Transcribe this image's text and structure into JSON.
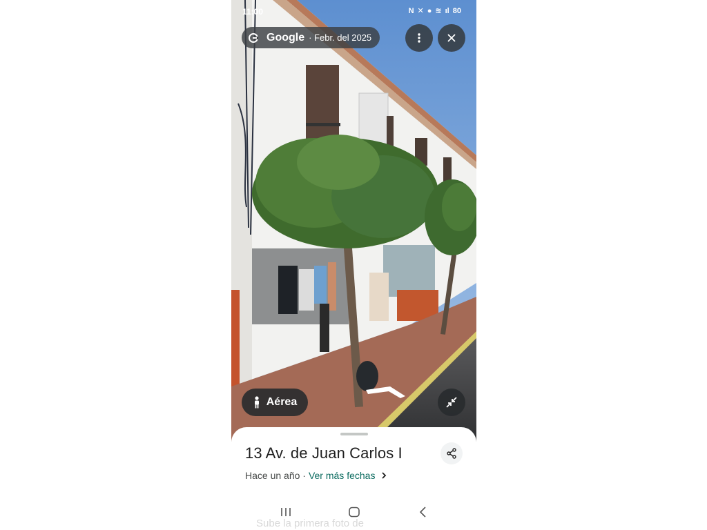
{
  "status": {
    "time": "11:00",
    "battery": "80"
  },
  "viewer": {
    "brand": "Google",
    "date": "· Febr. del 2025",
    "aerial_label": "Aérea"
  },
  "place": {
    "address": "13 Av. de Juan Carlos I",
    "age": "Hace un año ·",
    "more_dates": "Ver más fechas"
  },
  "ghost": {
    "text": "Sube la primera foto de"
  },
  "colors": {
    "link": "#0b6b5f",
    "pill_bg": "#3c4043",
    "sky": "#7ea6d8"
  },
  "icons": {
    "menu": "more-vert-icon",
    "close": "close-icon",
    "aerial": "pegman-icon",
    "shrink": "exit-fullscreen-icon",
    "share": "share-icon",
    "chevron": "chevron-right-icon"
  }
}
